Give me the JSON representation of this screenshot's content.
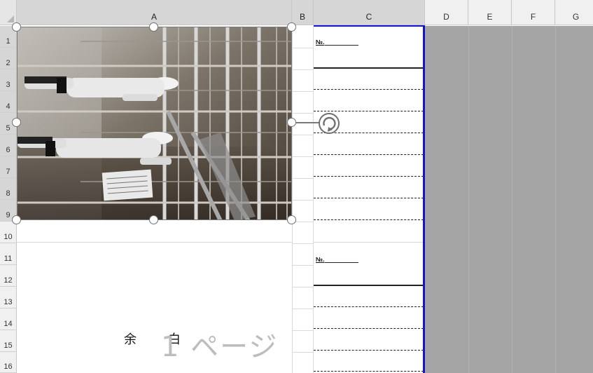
{
  "grid": {
    "columns": [
      {
        "label": "A",
        "selected": true
      },
      {
        "label": "B",
        "selected": true
      },
      {
        "label": "C",
        "selected": true
      },
      {
        "label": "D",
        "selected": false
      },
      {
        "label": "E",
        "selected": false
      },
      {
        "label": "F",
        "selected": false
      },
      {
        "label": "G",
        "selected": false
      }
    ],
    "rows": [
      "1",
      "2",
      "3",
      "4",
      "5",
      "6",
      "7",
      "8",
      "9",
      "10",
      "11",
      "12",
      "13",
      "14",
      "15",
      "16"
    ]
  },
  "cells": {
    "no_label_1": "№.",
    "no_label_2": "№."
  },
  "text": {
    "yohaku_left": "余",
    "yohaku_right": "白",
    "page_watermark": "1 ページ"
  },
  "image": {
    "description_icon": "photo-of-workers-in-scaffolding"
  },
  "colors": {
    "page_break": "#1414c8",
    "outside_print_area": "#a5a5a5",
    "selected_header": "#d6d6d6",
    "header": "#f0f0f0"
  }
}
